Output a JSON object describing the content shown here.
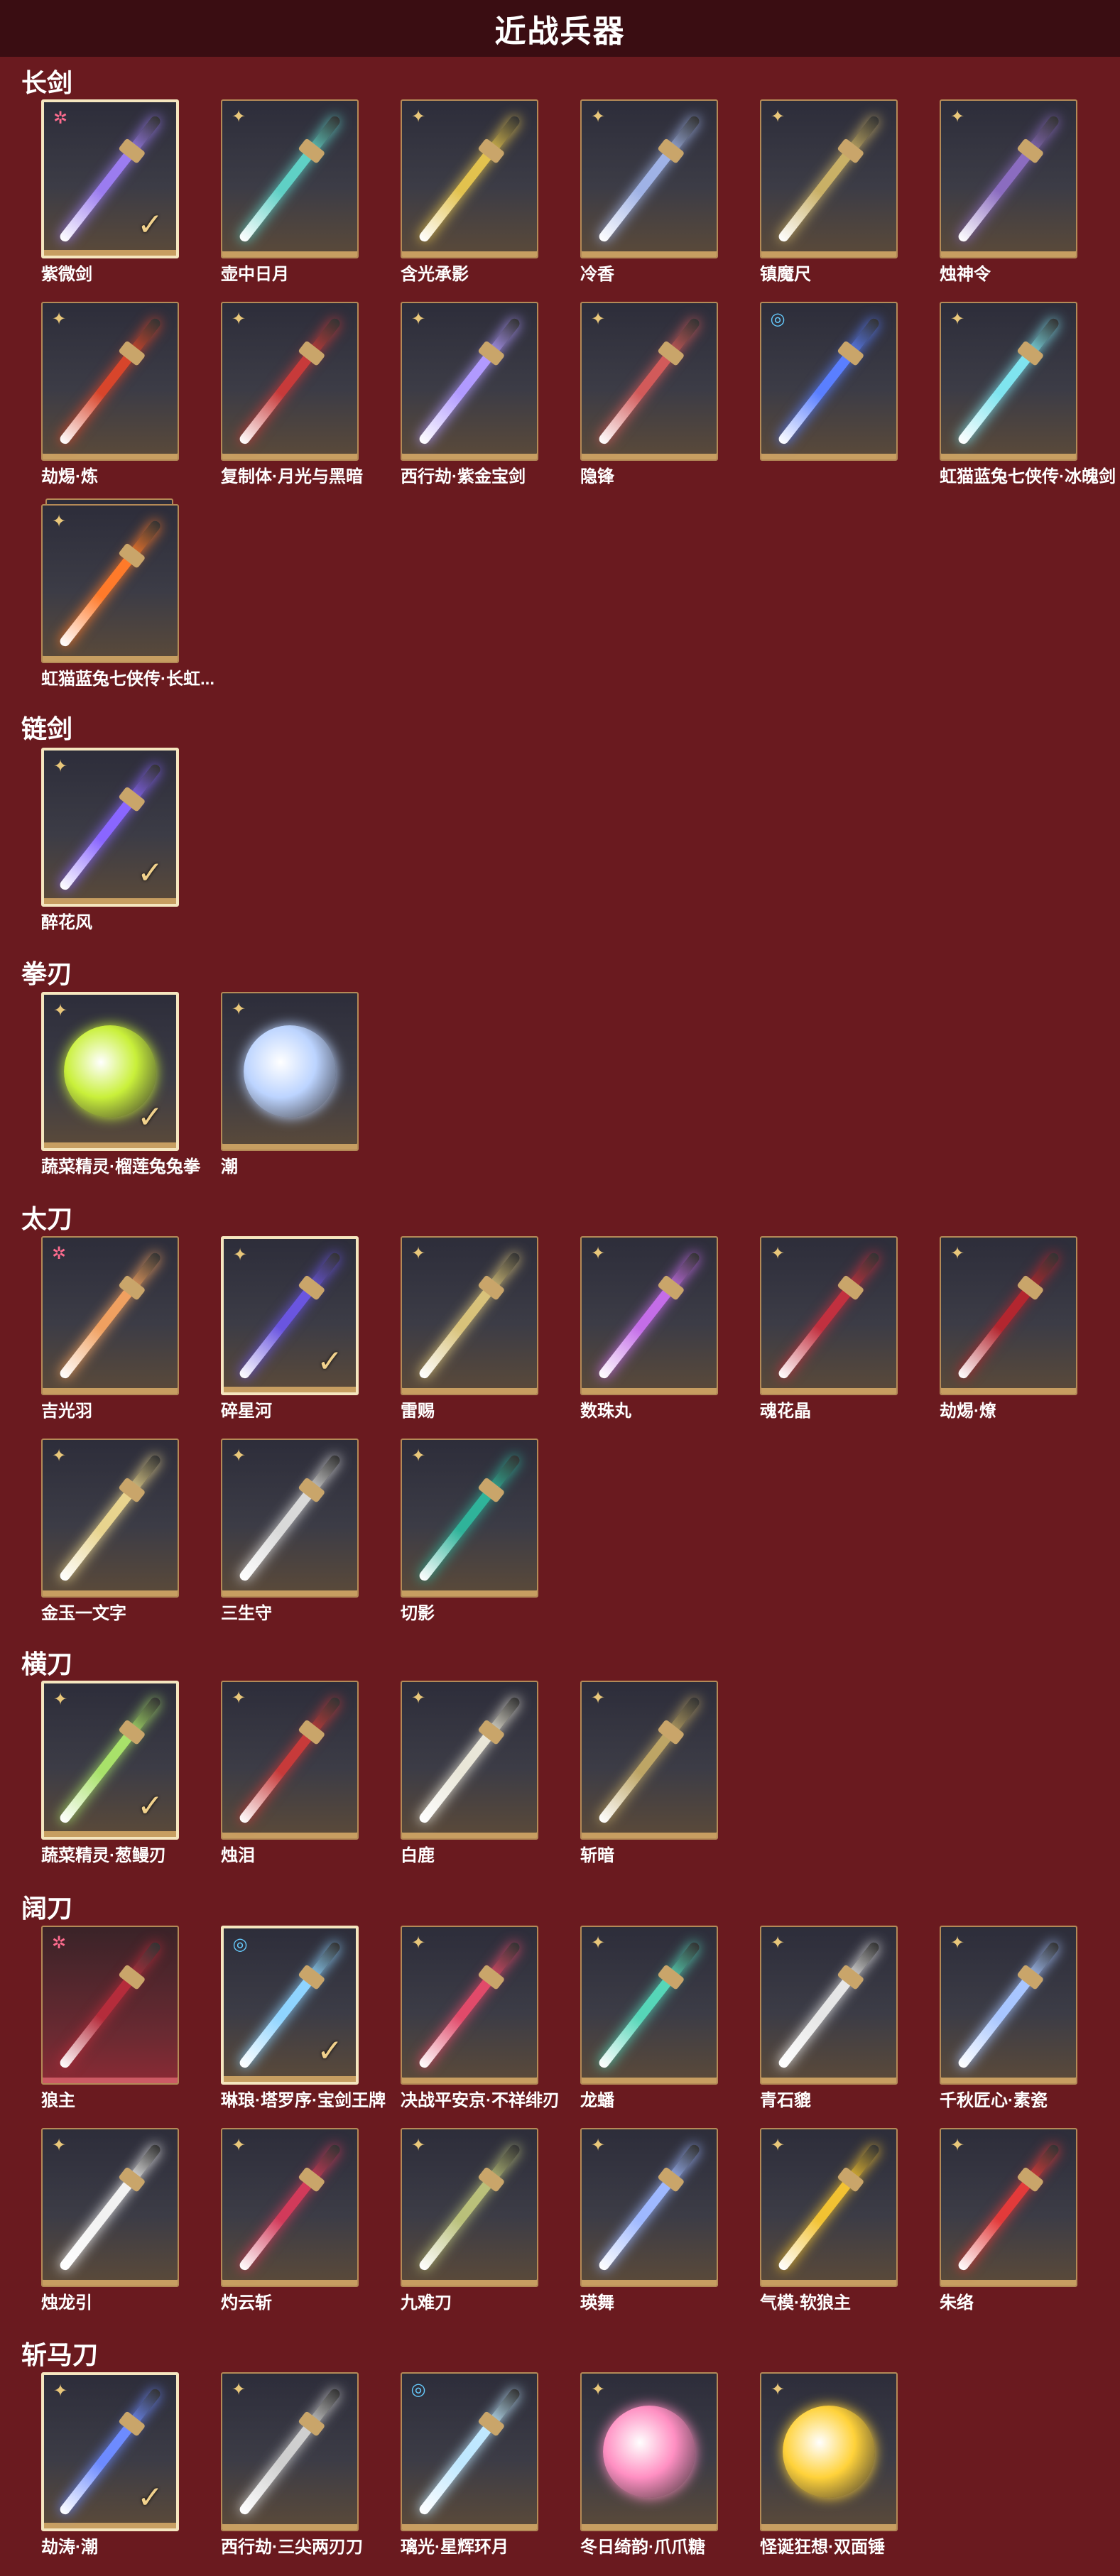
{
  "page": {
    "title": "近战兵器"
  },
  "sections": [
    {
      "title": "长剑",
      "items": [
        {
          "name": "紫微剑",
          "rarity": "pink-star",
          "selected": true,
          "color": "#9b7cf0"
        },
        {
          "name": "壶中日月",
          "rarity": "gold-cross",
          "color": "#5fd0c5"
        },
        {
          "name": "含光承影",
          "rarity": "gold-cross",
          "color": "#e2c24e"
        },
        {
          "name": "冷香",
          "rarity": "gold-cross",
          "color": "#9fb2e6"
        },
        {
          "name": "镇魔尺",
          "rarity": "gold-cross",
          "color": "#c9b066"
        },
        {
          "name": "烛神令",
          "rarity": "gold-cross",
          "color": "#8b6cc0"
        },
        {
          "name": "劫焬·炼",
          "rarity": "gold-cross",
          "color": "#d8452b"
        },
        {
          "name": "复制体·月光与黑暗",
          "rarity": "gold-cross",
          "color": "#c73a3a"
        },
        {
          "name": "西行劫·紫金宝剑",
          "rarity": "gold-cross",
          "color": "#b19aff"
        },
        {
          "name": "隐锋",
          "rarity": "gold-cross",
          "color": "#d25a5a"
        },
        {
          "name": "",
          "rarity": "rainbow",
          "color": "#5a7fff"
        },
        {
          "name": "虹猫蓝兔七侠传·冰魄剑",
          "rarity": "gold-cross",
          "color": "#7fe4ef"
        },
        {
          "name": "虹猫蓝兔七侠传·长虹...",
          "rarity": "gold-cross",
          "stack": true,
          "color": "#ff7a2a"
        }
      ]
    },
    {
      "title": "链剑",
      "items": [
        {
          "name": "醉花风",
          "rarity": "gold-cross",
          "selected": true,
          "color": "#8a66ff"
        }
      ]
    },
    {
      "title": "拳刃",
      "items": [
        {
          "name": "蔬菜精灵·榴莲兔兔拳",
          "rarity": "gold-cross",
          "selected": true,
          "color": "#c9f03a",
          "shape": "round"
        },
        {
          "name": "潮",
          "rarity": "gold-cross",
          "color": "#bcd4ff",
          "shape": "round"
        }
      ]
    },
    {
      "title": "太刀",
      "items": [
        {
          "name": "吉光羽",
          "rarity": "pink-star",
          "color": "#f0a060"
        },
        {
          "name": "碎星河",
          "rarity": "gold-cross",
          "selected": true,
          "color": "#6a55e0"
        },
        {
          "name": "雷赐",
          "rarity": "gold-cross",
          "color": "#d8c27a"
        },
        {
          "name": "数珠丸",
          "rarity": "gold-cross",
          "color": "#c46de8"
        },
        {
          "name": "魂花晶",
          "rarity": "gold-cross",
          "color": "#c2303f"
        },
        {
          "name": "劫焬·燎",
          "rarity": "gold-cross",
          "color": "#b3262f"
        },
        {
          "name": "金玉一文字",
          "rarity": "gold-cross",
          "color": "#e8d48e"
        },
        {
          "name": "三生守",
          "rarity": "gold-cross",
          "color": "#d9d9d9"
        },
        {
          "name": "切影",
          "rarity": "gold-cross",
          "color": "#2fb39a"
        }
      ]
    },
    {
      "title": "横刀",
      "items": [
        {
          "name": "蔬菜精灵·葱鳗刃",
          "rarity": "gold-cross",
          "selected": true,
          "color": "#a8e26a"
        },
        {
          "name": "烛泪",
          "rarity": "gold-cross",
          "color": "#c73a3a"
        },
        {
          "name": "白鹿",
          "rarity": "gold-cross",
          "color": "#e9e6d8"
        },
        {
          "name": "斩暗",
          "rarity": "gold-cross",
          "color": "#bda565"
        }
      ]
    },
    {
      "title": "阔刀",
      "items": [
        {
          "name": "狼主",
          "rarity": "pink-star",
          "red": true,
          "color": "#b52c3b"
        },
        {
          "name": "琳琅·塔罗序·宝剑王牌",
          "rarity": "rainbow",
          "selected": true,
          "color": "#8fd4ff"
        },
        {
          "name": "决战平安京·不祥绯刃",
          "rarity": "gold-cross",
          "color": "#e14a6a"
        },
        {
          "name": "龙蟠",
          "rarity": "gold-cross",
          "color": "#56d6b8"
        },
        {
          "name": "青石貔",
          "rarity": "gold-cross",
          "color": "#e6e6e6"
        },
        {
          "name": "千秋匠心·素瓷",
          "rarity": "gold-cross",
          "color": "#a8c6ff"
        },
        {
          "name": "烛龙引",
          "rarity": "gold-cross",
          "color": "#f2f2f2"
        },
        {
          "name": "灼云斩",
          "rarity": "gold-cross",
          "color": "#d23a5a"
        },
        {
          "name": "九难刀",
          "rarity": "gold-cross",
          "color": "#b9c07a"
        },
        {
          "name": "瑛舞",
          "rarity": "gold-cross",
          "color": "#9eb8ff"
        },
        {
          "name": "气模·软狼主",
          "rarity": "gold-cross",
          "color": "#f2c232"
        },
        {
          "name": "朱络",
          "rarity": "gold-cross",
          "color": "#e33a3a"
        }
      ]
    },
    {
      "title": "斩马刀",
      "items": [
        {
          "name": "劫涛·潮",
          "rarity": "gold-cross",
          "selected": true,
          "color": "#6d8bff"
        },
        {
          "name": "西行劫·三尖两刃刀",
          "rarity": "gold-cross",
          "color": "#cfcfcf"
        },
        {
          "name": "璃光·星辉环月",
          "rarity": "rainbow",
          "color": "#bfe8ff"
        },
        {
          "name": "冬日绮韵·爪爪糖",
          "rarity": "gold-cross",
          "color": "#ff8fc2",
          "shape": "round"
        },
        {
          "name": "怪诞狂想·双面锤",
          "rarity": "gold-cross",
          "color": "#ffd23a",
          "shape": "round"
        }
      ]
    }
  ]
}
